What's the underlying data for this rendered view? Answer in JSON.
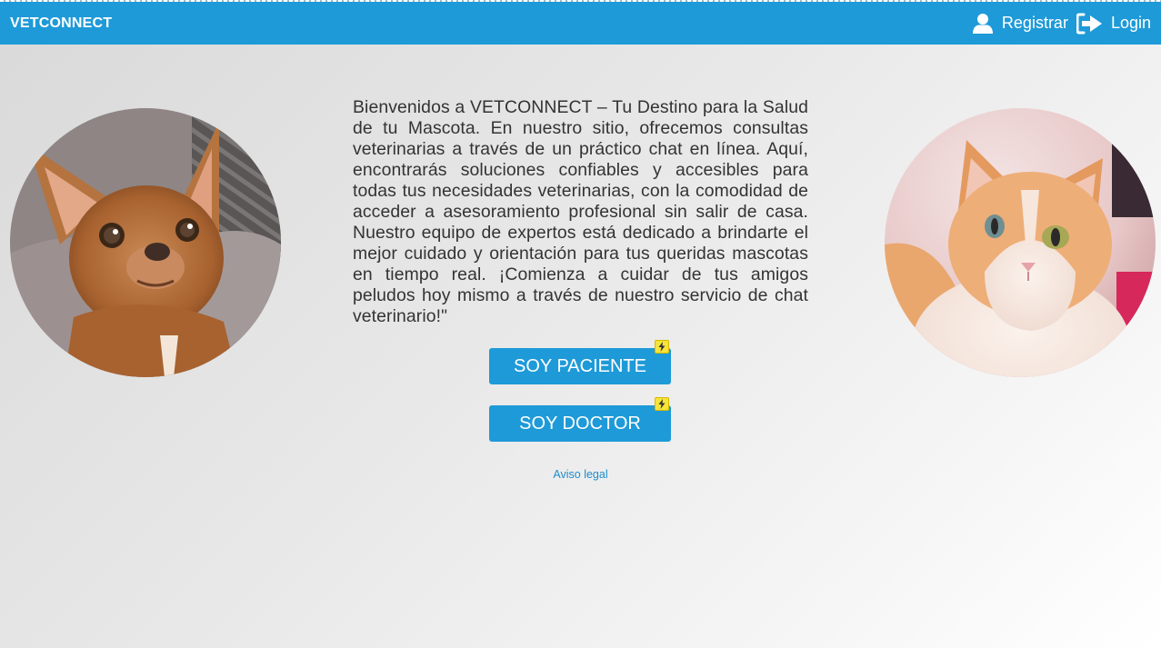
{
  "navbar": {
    "brand": "VETCONNECT",
    "register_label": "Registrar",
    "login_label": "Login",
    "background_color": "#1e9ad8"
  },
  "images": {
    "dog": "chihuahua-photo",
    "cat": "cat-photo"
  },
  "intro": {
    "text": "Bienvenidos a VETCONNECT – Tu Destino para la Salud de tu Mascota. En nuestro sitio, ofrecemos consultas veterinarias a través de un práctico chat en línea. Aquí, encontrarás soluciones confiables y accesibles para todas tus necesidades veterinarias, con la comodidad de acceder a asesoramiento profesional sin salir de casa. Nuestro equipo de expertos está dedicado a brindarte el mejor cuidado y orientación para tus queridas mascotas en tiempo real. ¡Comienza a cuidar de tus amigos peludos hoy mismo a través de nuestro servicio de chat veterinario!\""
  },
  "actions": {
    "patient_label": "SOY PACIENTE",
    "doctor_label": "SOY DOCTOR",
    "badge_icon": "lightning-bolt-icon"
  },
  "footer": {
    "legal_label": "Aviso legal",
    "link_color": "#1e8ccc"
  }
}
